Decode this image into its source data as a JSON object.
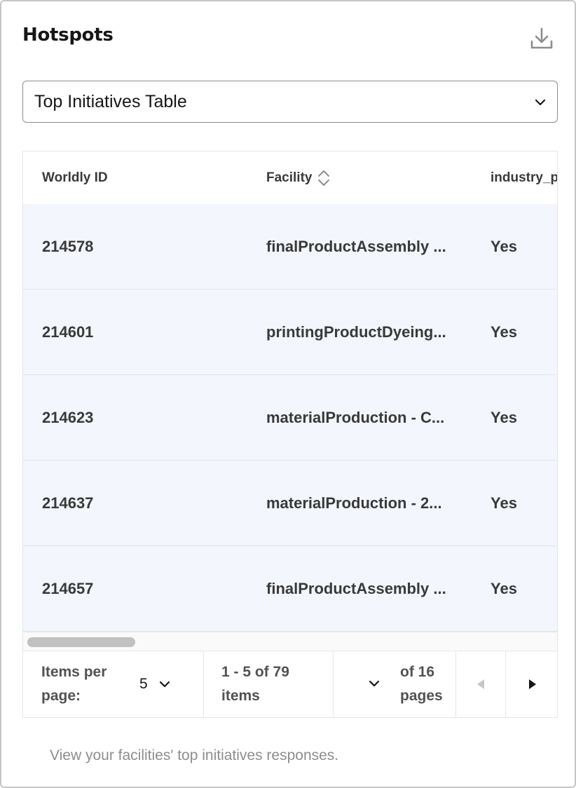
{
  "header": {
    "title": "Hotspots",
    "download_icon": "download-icon"
  },
  "selector": {
    "value": "Top Initiatives Table",
    "icon": "chevron-down-icon"
  },
  "table": {
    "columns": [
      {
        "label": "Worldly ID"
      },
      {
        "label": "Facility",
        "sort_icon": "sort-icon"
      },
      {
        "label": "industry_p"
      }
    ],
    "rows": [
      {
        "id": "214578",
        "facility": "finalProductAssembly ...",
        "value": "Yes"
      },
      {
        "id": "214601",
        "facility": "printingProductDyeing...",
        "value": "Yes"
      },
      {
        "id": "214623",
        "facility": "materialProduction - C...",
        "value": "Yes"
      },
      {
        "id": "214637",
        "facility": "materialProduction - 2...",
        "value": "Yes"
      },
      {
        "id": "214657",
        "facility": "finalProductAssembly ...",
        "value": "Yes"
      }
    ],
    "row_background": "#f3f6fc"
  },
  "pagination": {
    "items_per_page_line1": "Items per",
    "items_per_page_line2": "page:",
    "items_per_page_value": "5",
    "range_line1": "1 - 5 of 79",
    "range_line2": "items",
    "of_pages_line1": "of 16",
    "of_pages_line2": "pages"
  },
  "footnote": "View your facilities' top initiatives responses."
}
